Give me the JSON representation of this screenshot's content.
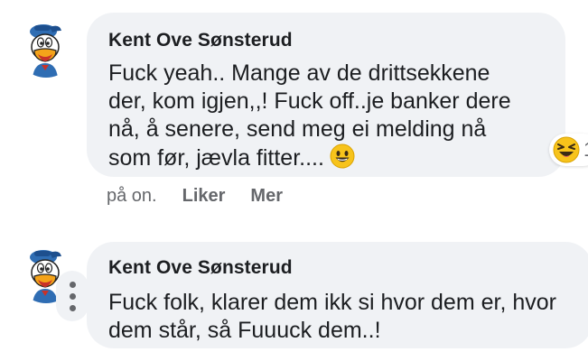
{
  "comments": [
    {
      "author": "Kent Ove Sønsterud",
      "text": "Fuck yeah.. Mange av de drittsekkene\nder, kom igjen,,! Fuck off..je banker dere\nnå, å senere, send meg ei melding nå\nsom før, jævla fitter....",
      "inline_emoji": "grinning-face-icon",
      "reaction": {
        "emoji": "laughing-face-icon",
        "count": "1"
      },
      "time": "på on.",
      "like_label": "Liker",
      "more_label": "Mer"
    },
    {
      "author": "Kent Ove Sønsterud",
      "text": "Fuck folk, klarer dem ikk si hvor dem er, hvor\ndem står, så Fuuuck dem..!"
    }
  ],
  "colors": {
    "bubble_bg": "#f0f2f5",
    "text": "#1c1e21",
    "secondary": "#65676b",
    "emoji_yellow": "#f7c31b",
    "duck_blue": "#2f6db3",
    "duck_beak": "#f4a31a"
  }
}
